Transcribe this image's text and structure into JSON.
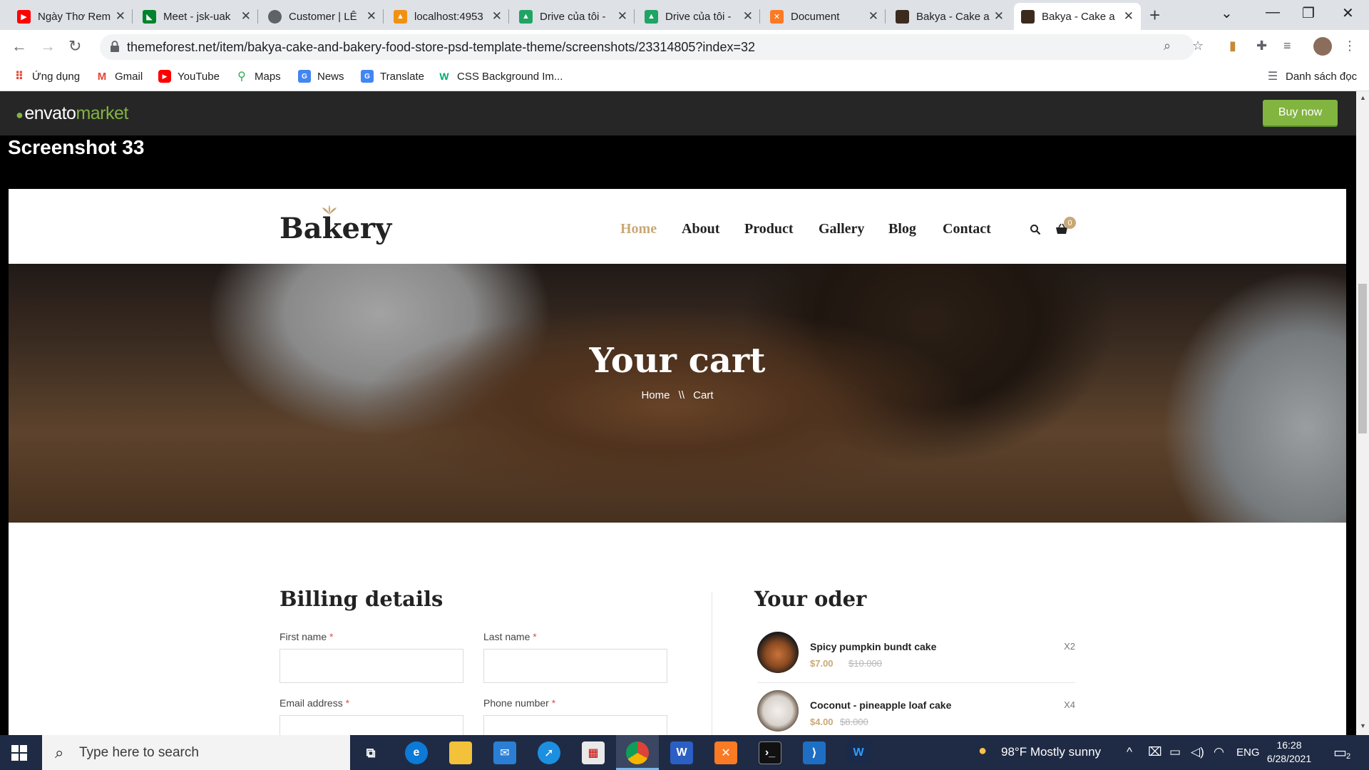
{
  "browser": {
    "tabs": [
      {
        "title": "Ngày Thơ Rem",
        "icon": "youtube-icon",
        "color": "#ff0000"
      },
      {
        "title": "Meet - jsk-uak",
        "icon": "meet-icon",
        "color": "#00832d"
      },
      {
        "title": "Customer | LÊ",
        "icon": "globe-icon",
        "color": "#5f6368"
      },
      {
        "title": "localhost:4953",
        "icon": "phpmyadmin-icon",
        "color": "#f29111"
      },
      {
        "title": "Drive của tôi -",
        "icon": "drive-icon",
        "color": "#1fa463"
      },
      {
        "title": "Drive của tôi -",
        "icon": "drive-icon",
        "color": "#1fa463"
      },
      {
        "title": "Document",
        "icon": "xampp-icon",
        "color": "#fb7a24"
      },
      {
        "title": "Bakya - Cake a",
        "icon": "bakya-icon",
        "color": "#3b2a1e"
      },
      {
        "title": "Bakya - Cake a",
        "icon": "bakya-icon",
        "color": "#3b2a1e"
      }
    ],
    "url": "themeforest.net/item/bakya-cake-and-bakery-food-store-psd-template-theme/screenshots/23314805?index=32",
    "bookmarks": [
      {
        "label": "Ứng dụng",
        "icon": "apps-grid-icon"
      },
      {
        "label": "Gmail",
        "icon": "gmail-icon"
      },
      {
        "label": "YouTube",
        "icon": "youtube-icon"
      },
      {
        "label": "Maps",
        "icon": "maps-pin-icon"
      },
      {
        "label": "News",
        "icon": "news-icon"
      },
      {
        "label": "Translate",
        "icon": "translate-icon"
      },
      {
        "label": "CSS Background Im...",
        "icon": "w3-icon"
      }
    ],
    "reading_list": "Danh sách đọc"
  },
  "envato": {
    "logo_word": "envato",
    "logo_market": "market",
    "buy_now": "Buy now",
    "brand_color": "#82b440"
  },
  "screenshot_title": "Screenshot 33",
  "site": {
    "logo": "Bakery",
    "menu": [
      "Home",
      "About",
      "Product",
      "Gallery",
      "Blog",
      "Contact"
    ],
    "active_menu": "Home",
    "accent_color": "#c9a876",
    "cart_count": "0",
    "hero": {
      "title": "Your cart",
      "breadcrumb_home": "Home",
      "breadcrumb_sep": "\\\\",
      "breadcrumb_current": "Cart"
    },
    "billing": {
      "title": "Billing details",
      "fields": [
        {
          "label": "First name",
          "required": "*"
        },
        {
          "label": "Last name",
          "required": "*"
        },
        {
          "label": "Email address",
          "required": "*"
        },
        {
          "label": "Phone number",
          "required": "*"
        }
      ]
    },
    "order": {
      "title": "Your oder",
      "items": [
        {
          "name": "Spicy pumpkin bundt cake",
          "price": "$7.00",
          "old_price": "$10.000",
          "qty": "X2"
        },
        {
          "name": "Coconut - pineapple loaf cake",
          "price": "$4.00",
          "old_price": "$8.000",
          "qty": "X4"
        }
      ]
    }
  },
  "taskbar": {
    "search_placeholder": "Type here to search",
    "weather": "98°F  Mostly sunny",
    "lang": "ENG",
    "time": "16:28",
    "date": "6/28/2021",
    "notifications": "2"
  }
}
